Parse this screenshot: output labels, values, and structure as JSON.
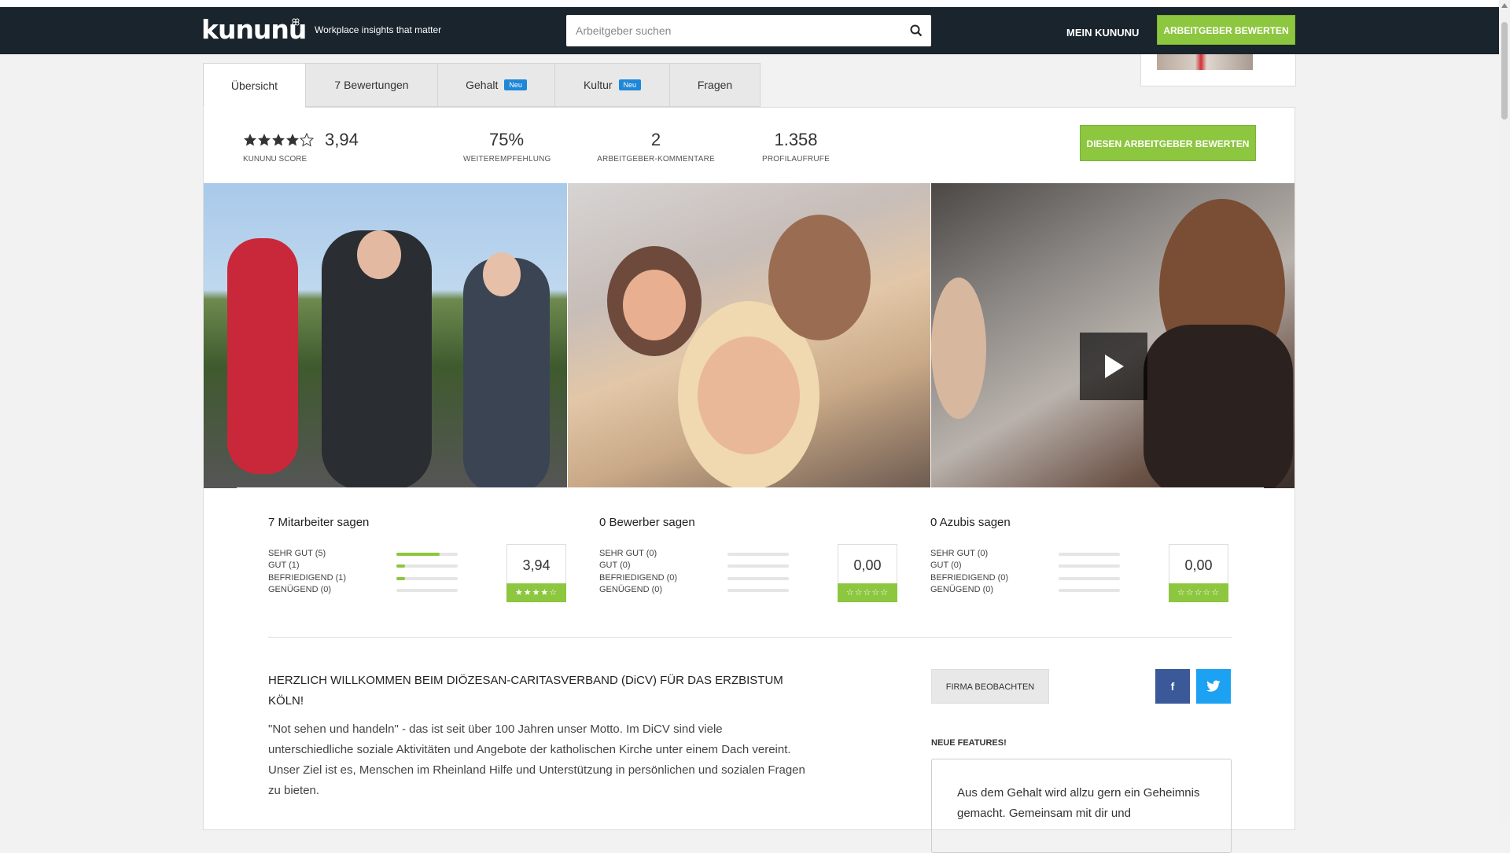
{
  "header": {
    "logo": "kununu",
    "tagline": "Workplace insights that matter",
    "search_placeholder": "Arbeitgeber suchen",
    "mein": "MEIN KUNUNU",
    "cta": "ARBEITGEBER BEWERTEN"
  },
  "tabs": [
    {
      "label": "Übersicht",
      "badge": ""
    },
    {
      "label": "7 Bewertungen",
      "badge": ""
    },
    {
      "label": "Gehalt",
      "badge": "Neu"
    },
    {
      "label": "Kultur",
      "badge": "Neu"
    },
    {
      "label": "Fragen",
      "badge": ""
    }
  ],
  "stats": {
    "score_value": "3,94",
    "score_stars": 3.94,
    "score_label": "KUNUNU SCORE",
    "recommend_value": "75%",
    "recommend_label": "WEITEREMPFEHLUNG",
    "comments_value": "2",
    "comments_label": "ARBEITGEBER-KOMMENTARE",
    "views_value": "1.358",
    "views_label": "PROFILAUFRUFE",
    "rate_button": "DIESEN ARBEITGEBER BEWERTEN"
  },
  "groups": [
    {
      "title": "7 Mitarbeiter sagen",
      "rows": [
        {
          "label": "SEHR GUT (5)",
          "fraction": 0.71
        },
        {
          "label": "GUT (1)",
          "fraction": 0.14
        },
        {
          "label": "BEFRIEDIGEND (1)",
          "fraction": 0.14
        },
        {
          "label": "GENÜGEND (0)",
          "fraction": 0
        }
      ],
      "score": "3,94",
      "stars": "★★★★☆"
    },
    {
      "title": "0 Bewerber sagen",
      "rows": [
        {
          "label": "SEHR GUT (0)",
          "fraction": 0
        },
        {
          "label": "GUT (0)",
          "fraction": 0
        },
        {
          "label": "BEFRIEDIGEND (0)",
          "fraction": 0
        },
        {
          "label": "GENÜGEND (0)",
          "fraction": 0
        }
      ],
      "score": "0,00",
      "stars": "☆☆☆☆☆"
    },
    {
      "title": "0 Azubis sagen",
      "rows": [
        {
          "label": "SEHR GUT (0)",
          "fraction": 0
        },
        {
          "label": "GUT (0)",
          "fraction": 0
        },
        {
          "label": "BEFRIEDIGEND (0)",
          "fraction": 0
        },
        {
          "label": "GENÜGEND (0)",
          "fraction": 0
        }
      ],
      "score": "0,00",
      "stars": "☆☆☆☆☆"
    }
  ],
  "about": {
    "title": "HERZLICH WILLKOMMEN BEIM DIÖZESAN-CARITASVERBAND (DiCV) FÜR DAS ERZBISTUM KÖLN!",
    "text": "\"Not sehen und handeln\" - das ist seit über 100 Jahren unser Motto. Im DiCV sind viele unterschiedliche soziale Aktivitäten und Angebote der katholischen Kirche unter einem Dach vereint. Unser Ziel ist es, Menschen im Rheinland Hilfe und Unterstützung in persönlichen und sozialen Fragen zu bieten."
  },
  "sidebar": {
    "follow": "FIRMA BEOBACHTEN",
    "facebook": "f",
    "new_features_title": "NEUE FEATURES!",
    "new_features_text": "Aus dem Gehalt wird allzu gern ein Geheimnis gemacht. Gemeinsam mit dir und"
  },
  "colors": {
    "nav_bg": "#1a242c",
    "accent_green": "#8dc63f",
    "badge_blue": "#1e87d8",
    "facebook": "#3b5998",
    "twitter": "#1da1f2"
  }
}
